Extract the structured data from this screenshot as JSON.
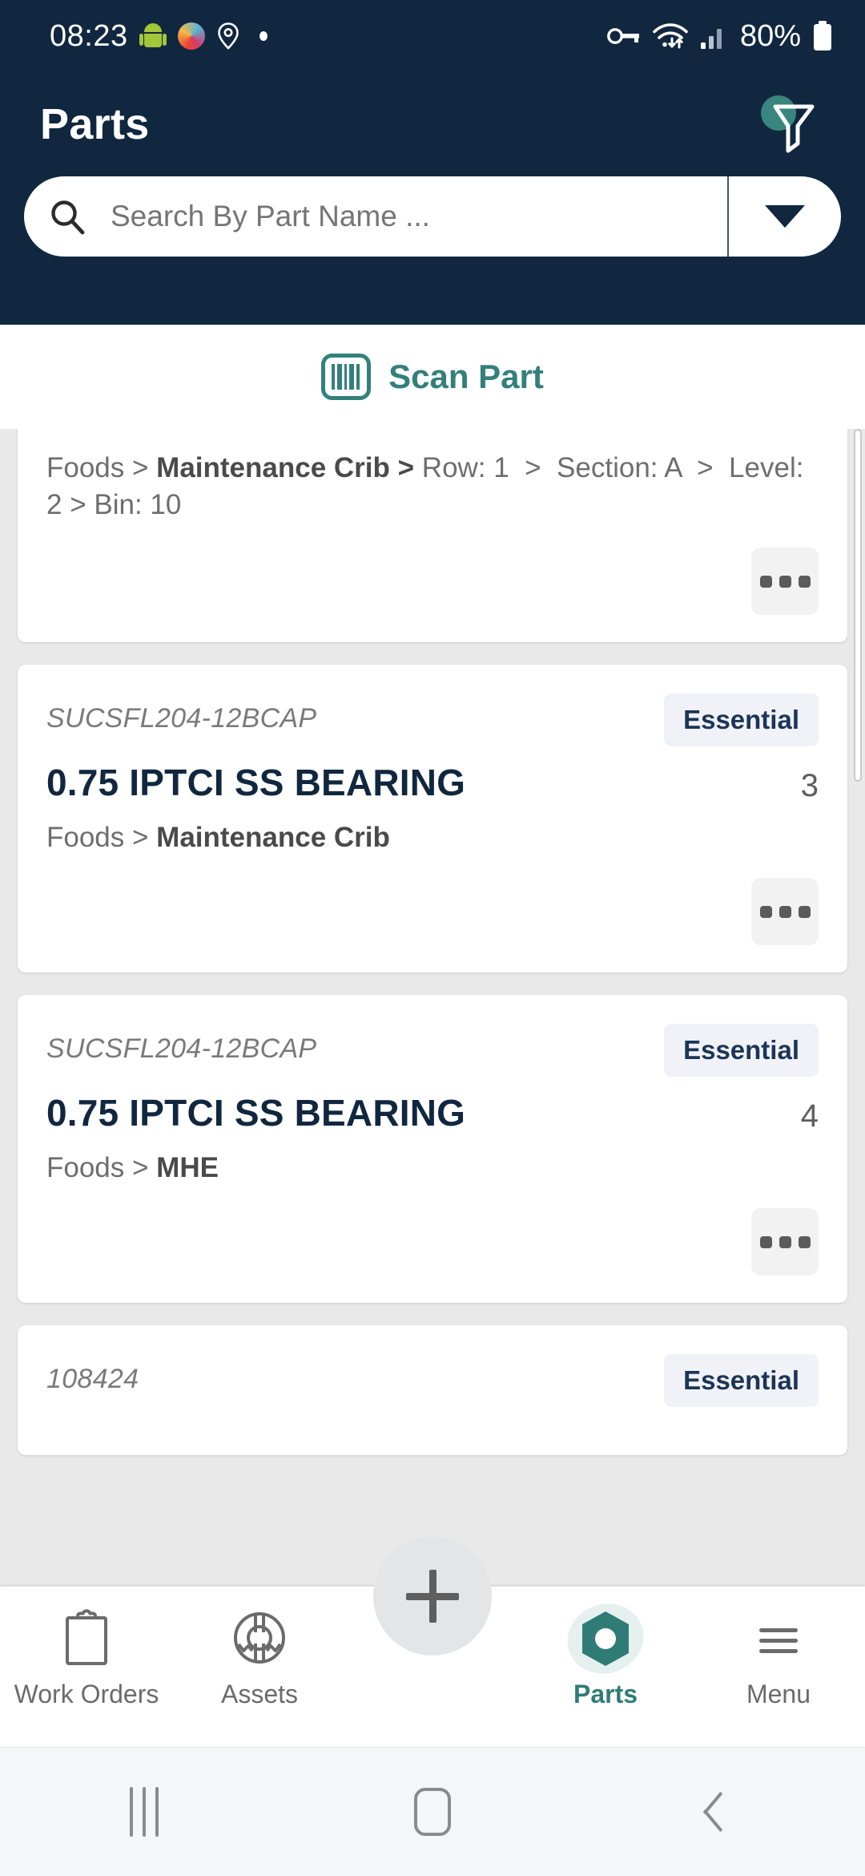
{
  "statusbar": {
    "time": "08:23",
    "icons_left": [
      "android-robot-icon",
      "chromatic-app-icon",
      "location-pin-icon",
      "dot-icon"
    ],
    "icons_right": [
      "vpn-key-icon",
      "wifi-icon",
      "cellular-signal-icon"
    ],
    "battery_percent": "80%",
    "battery_icon": "battery-icon"
  },
  "header": {
    "title": "Parts",
    "filter_icon": "filter-funnel-icon",
    "filter_badge_color": "#39857F",
    "background_color": "#10273F"
  },
  "search": {
    "placeholder": "Search By Part Name ...",
    "value": "",
    "search_icon": "search-icon",
    "dropdown_icon": "chevron-down-icon"
  },
  "scan": {
    "label": "Scan Part",
    "icon": "barcode-icon",
    "color": "#33807B"
  },
  "list": {
    "overflow_icon": "more-horizontal-icon",
    "cards": [
      {
        "partial_top": true,
        "sku": "",
        "badge": "",
        "name": "",
        "qty": "",
        "breadcrumb_html": "Foods &gt; <b>Maintenance Crib &gt;</b> Row: 1 &nbsp;&gt;&nbsp; Section: A &nbsp;&gt;&nbsp; Level: 2 &gt; Bin: 10"
      },
      {
        "sku": "SUCSFL204-12BCAP",
        "badge": "Essential",
        "name": "0.75 IPTCI SS BEARING",
        "qty": "3",
        "location_prefix": "Foods > ",
        "location_bold": "Maintenance Crib"
      },
      {
        "sku": "SUCSFL204-12BCAP",
        "badge": "Essential",
        "name": "0.75 IPTCI SS BEARING",
        "qty": "4",
        "location_prefix": "Foods > ",
        "location_bold": "MHE"
      },
      {
        "sku": "108424",
        "badge": "Essential",
        "partial_bottom": true
      }
    ]
  },
  "bottomnav": {
    "items": [
      {
        "label": "Work Orders",
        "icon": "clipboard-icon",
        "active": false
      },
      {
        "label": "Assets",
        "icon": "asset-gear-icon",
        "active": false
      },
      {
        "label": "Parts",
        "icon": "hex-nut-icon",
        "active": true
      },
      {
        "label": "Menu",
        "icon": "hamburger-menu-icon",
        "active": false
      }
    ],
    "fab": {
      "icon": "plus-icon",
      "label": ""
    },
    "active_color": "#2F7C77",
    "inactive_color": "#6B6B6B"
  },
  "sysnav": {
    "recents_icon": "recents-icon",
    "home_icon": "home-icon",
    "back_icon": "back-icon"
  }
}
